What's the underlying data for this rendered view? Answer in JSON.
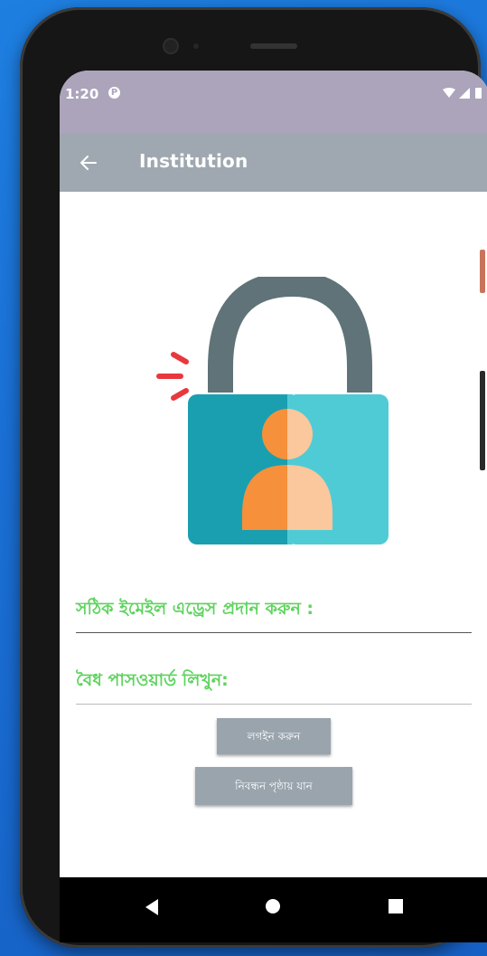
{
  "status_bar": {
    "time": "1:20",
    "notification_badge": "P",
    "icons": [
      "wifi-icon",
      "signal-icon",
      "battery-icon"
    ]
  },
  "app_bar": {
    "title": "Institution",
    "back_icon": "arrow-left-icon"
  },
  "illustration": {
    "name": "unlocked-padlock-user-icon",
    "colors": {
      "shackle": "#5f7378",
      "body_left": "#1a9fb0",
      "body_right": "#4fcbd6",
      "person_left": "#f6903a",
      "person_right": "#fbc79c",
      "alert_marks": "#e8373d"
    }
  },
  "form": {
    "email_label": "সঠিক ইমেইল এড্রেস প্রদান করুন :",
    "password_label": "বৈধ পাসওয়ার্ড লিখুন:",
    "login_button": "লগইন করুন",
    "register_button": "নিবন্ধন পৃষ্ঠায় যান"
  },
  "nav_bar": {
    "back": "triangle-back-icon",
    "home": "circle-home-icon",
    "recents": "square-recents-icon"
  },
  "colors": {
    "status_bar": "#aba4bb",
    "app_bar": "#9fa8b0",
    "label_green": "#5fd35f",
    "button": "#9aa4ad"
  }
}
